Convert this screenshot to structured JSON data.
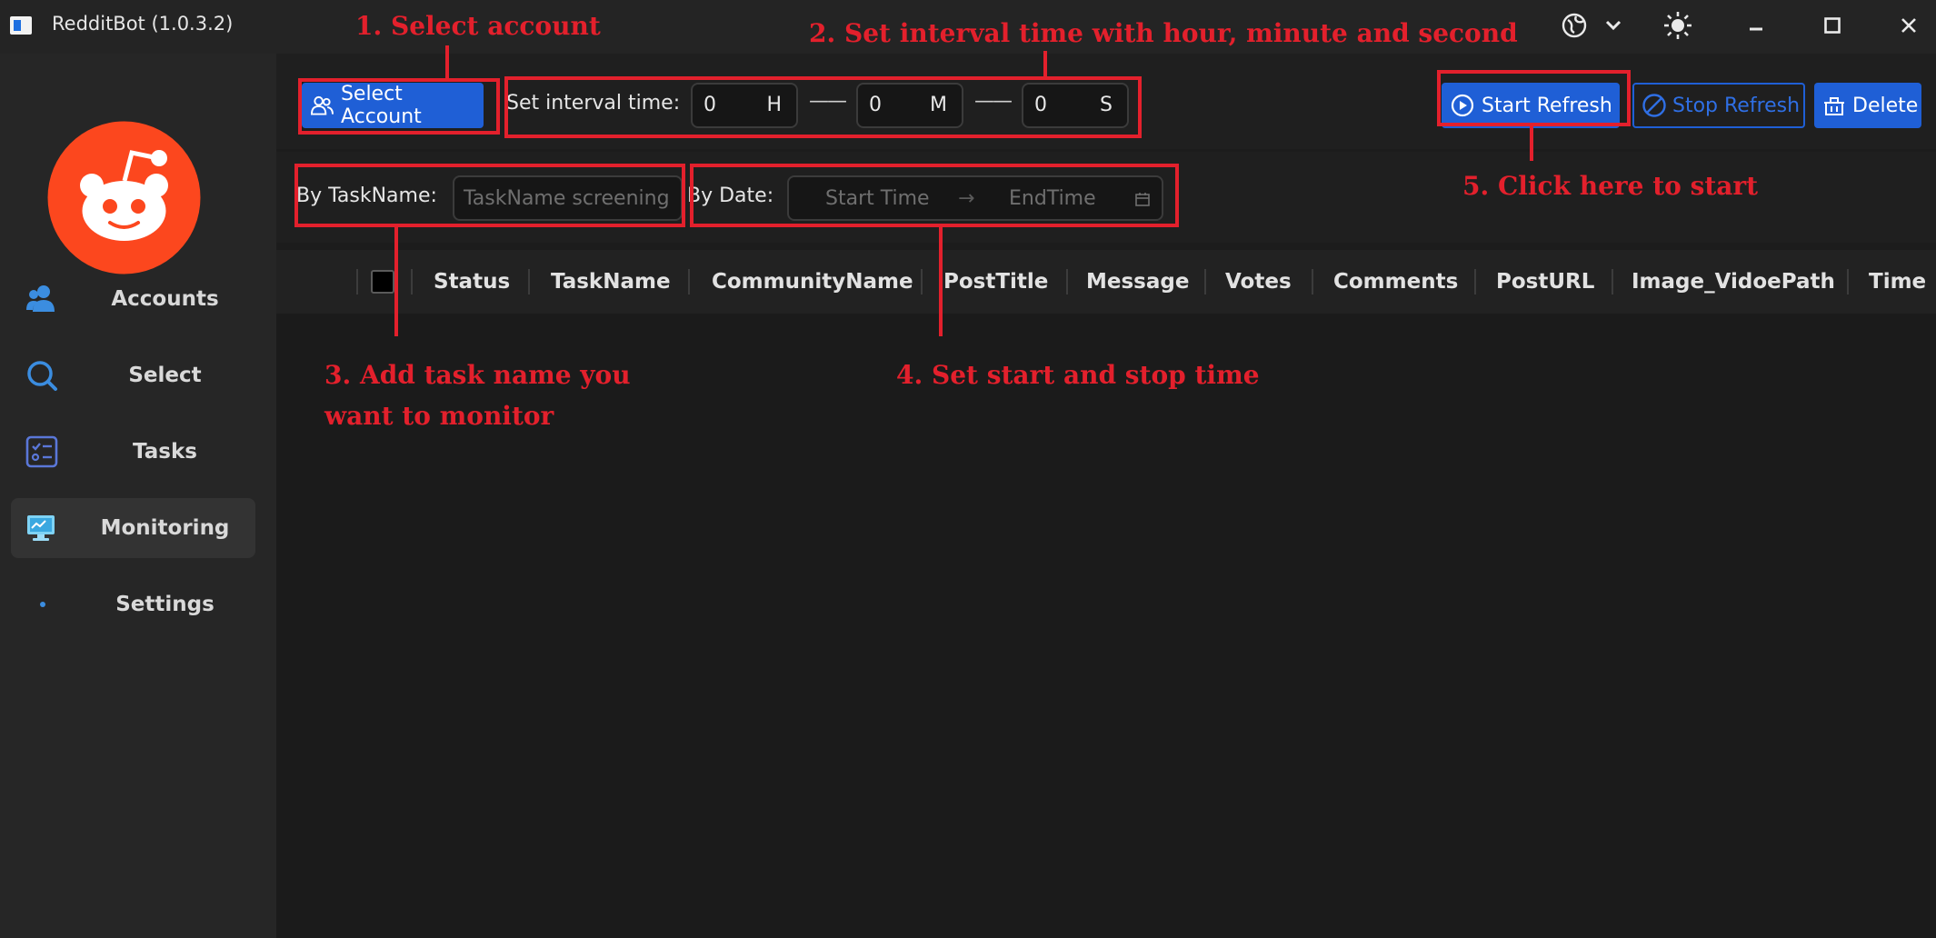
{
  "window": {
    "title": "RedditBot (1.0.3.2)",
    "icons": [
      "globe-icon",
      "chevron-down-icon",
      "sun-icon",
      "minimize-icon",
      "maximize-icon",
      "close-icon"
    ]
  },
  "sidebar": {
    "items": [
      {
        "label": "Accounts",
        "icon": "accounts-icon"
      },
      {
        "label": "Select",
        "icon": "search-icon"
      },
      {
        "label": "Tasks",
        "icon": "tasks-icon"
      },
      {
        "label": "Monitoring",
        "icon": "monitor-icon",
        "active": true
      },
      {
        "label": "Settings",
        "icon": "dot-icon"
      }
    ]
  },
  "toolbar": {
    "select_account": "Select Account",
    "interval_label": "Set interval time:",
    "hours": {
      "value": "0",
      "unit": "H"
    },
    "minutes": {
      "value": "0",
      "unit": "M"
    },
    "seconds": {
      "value": "0",
      "unit": "S"
    },
    "separator": "——",
    "start_refresh": "Start Refresh",
    "stop_refresh": "Stop Refresh",
    "delete": "Delete"
  },
  "filters": {
    "taskname_label": "By TaskName:",
    "taskname_placeholder": "TaskName screening",
    "date_label": "By Date:",
    "start_placeholder": "Start Time",
    "arrow": "→",
    "end_placeholder": "EndTime"
  },
  "table": {
    "columns": [
      "Status",
      "TaskName",
      "CommunityName",
      "PostTitle",
      "Message",
      "Votes",
      "Comments",
      "PostURL",
      "Image_VidoePath",
      "Time"
    ]
  },
  "annotations": {
    "a1": "1. Select account",
    "a2": "2. Set interval time with hour, minute and second",
    "a3_line1": "3. Add task name you",
    "a3_line2": "want to monitor",
    "a4": "4. Set start and stop time",
    "a5": "5. Click here to start"
  },
  "colors": {
    "accent": "#1f5fd6",
    "annotation": "#e3202c",
    "reddit_orange": "#fc471e"
  }
}
